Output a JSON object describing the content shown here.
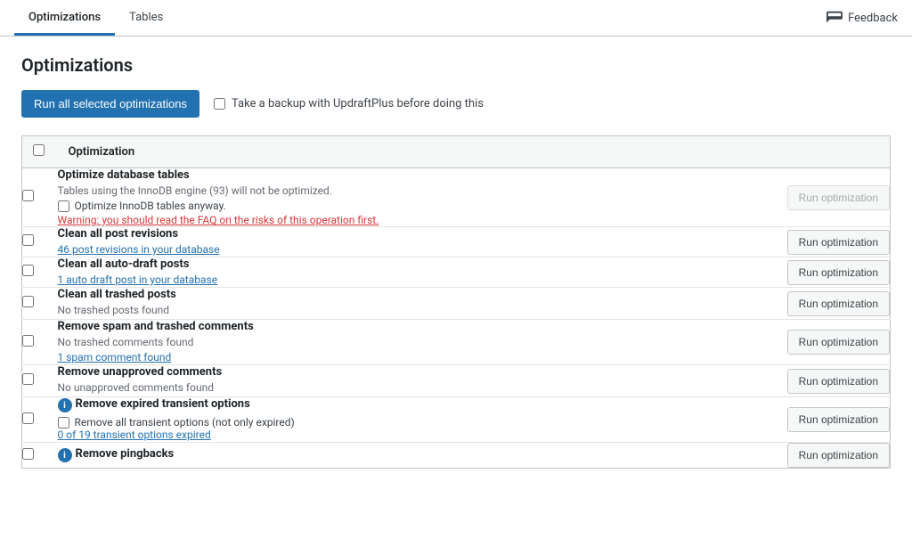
{
  "tabs": [
    {
      "id": "optimizations",
      "label": "Optimizations",
      "active": true
    },
    {
      "id": "tables",
      "label": "Tables",
      "active": false
    }
  ],
  "feedback": {
    "label": "Feedback"
  },
  "page": {
    "title": "Optimizations"
  },
  "toolbar": {
    "run_all_label": "Run all selected optimizations",
    "backup_checkbox_label": "Take a backup with UpdraftPlus before doing this"
  },
  "table": {
    "header": "Optimization",
    "rows": [
      {
        "id": "optimize-db-tables",
        "title": "Optimize database tables",
        "has_info": false,
        "desc": "Tables using the InnoDB engine (93) will not be optimized.",
        "sub_check": "Optimize InnoDB tables anyway.",
        "warning_link": "Warning: you should read the FAQ on the risks of this operation first.",
        "link": null,
        "extra_desc": null,
        "run_label": "Run optimization",
        "disabled": true
      },
      {
        "id": "clean-post-revisions",
        "title": "Clean all post revisions",
        "has_info": false,
        "link": "46 post revisions in your database",
        "desc": null,
        "sub_check": null,
        "warning_link": null,
        "extra_desc": null,
        "run_label": "Run optimization",
        "disabled": false
      },
      {
        "id": "clean-auto-draft",
        "title": "Clean all auto-draft posts",
        "has_info": false,
        "link": "1 auto draft post in your database",
        "desc": null,
        "sub_check": null,
        "warning_link": null,
        "extra_desc": null,
        "run_label": "Run optimization",
        "disabled": false
      },
      {
        "id": "clean-trashed-posts",
        "title": "Clean all trashed posts",
        "has_info": false,
        "desc": "No trashed posts found",
        "link": null,
        "sub_check": null,
        "warning_link": null,
        "extra_desc": null,
        "run_label": "Run optimization",
        "disabled": false
      },
      {
        "id": "remove-spam-comments",
        "title": "Remove spam and trashed comments",
        "has_info": false,
        "link": "1 spam comment found",
        "desc": "No trashed comments found",
        "sub_check": null,
        "warning_link": null,
        "extra_desc": null,
        "run_label": "Run optimization",
        "disabled": false
      },
      {
        "id": "remove-unapproved-comments",
        "title": "Remove unapproved comments",
        "has_info": false,
        "desc": "No unapproved comments found",
        "link": null,
        "sub_check": null,
        "warning_link": null,
        "extra_desc": null,
        "run_label": "Run optimization",
        "disabled": false
      },
      {
        "id": "remove-expired-transient",
        "title": "Remove expired transient options",
        "has_info": true,
        "link": "0 of 19 transient options expired",
        "desc": null,
        "sub_check": "Remove all transient options (not only expired)",
        "warning_link": null,
        "extra_desc": null,
        "run_label": "Run optimization",
        "disabled": false
      },
      {
        "id": "remove-pingbacks",
        "title": "Remove pingbacks",
        "has_info": true,
        "link": null,
        "desc": null,
        "sub_check": null,
        "warning_link": null,
        "extra_desc": null,
        "run_label": "Run optimization",
        "disabled": false
      }
    ]
  }
}
